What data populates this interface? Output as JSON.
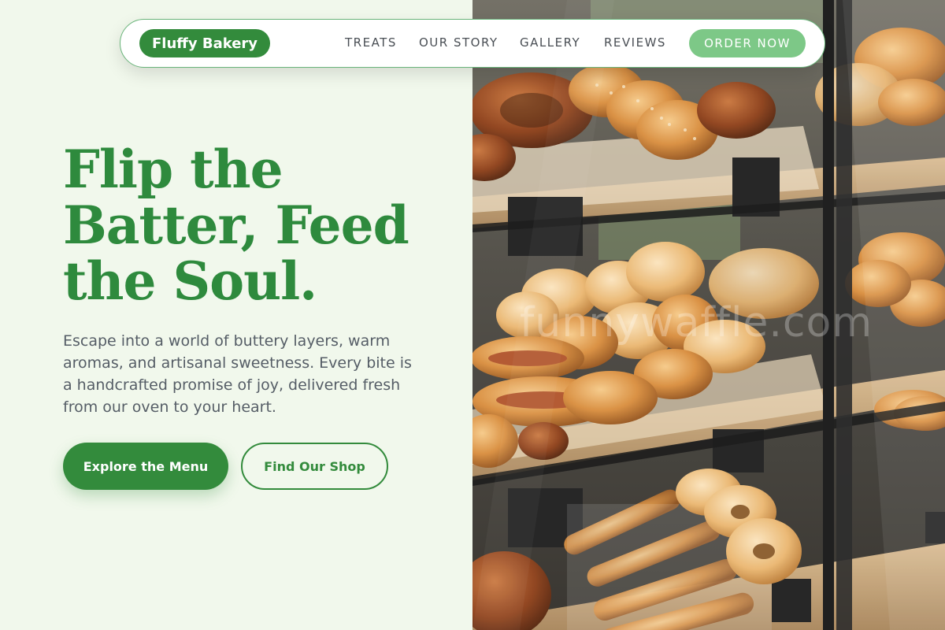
{
  "nav": {
    "logo": "Fluffy Bakery",
    "links": [
      "TREATS",
      "OUR STORY",
      "GALLERY",
      "REVIEWS"
    ],
    "cta": "ORDER NOW"
  },
  "hero": {
    "headline": "Flip the Batter, Feed the Soul.",
    "tagline": "Escape into a world of buttery layers, warm aromas, and artisanal sweetness. Every bite is a handcrafted promise of joy, delivered fresh from our oven to your heart.",
    "primary_button": "Explore the Menu",
    "secondary_button": "Find Our Shop"
  },
  "photo": {
    "subject": "bakery display case with pastries and breads",
    "watermark": "funnywaffle.com"
  },
  "colors": {
    "brand_green": "#338b3c",
    "headline_green": "#2e8a3d",
    "cta_light_green": "#7dc887",
    "background": "#f1f8ec"
  }
}
